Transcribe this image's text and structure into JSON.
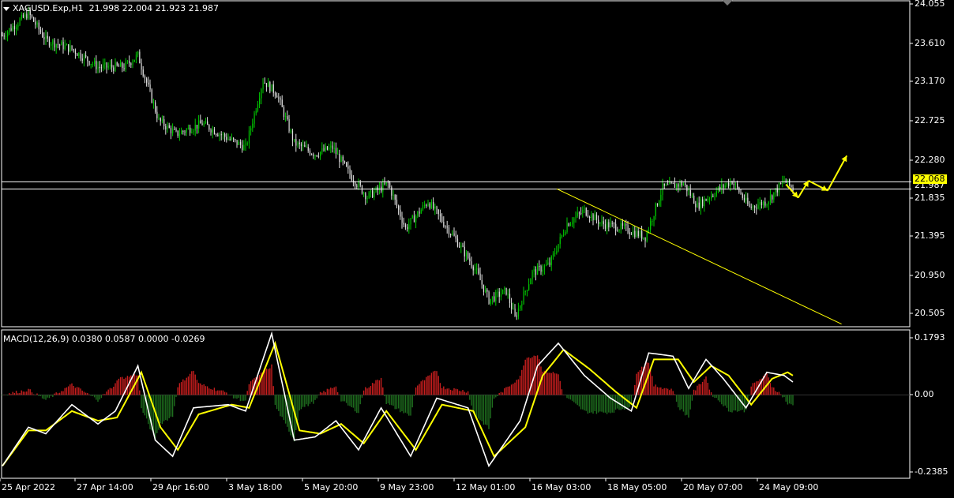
{
  "header": {
    "symbol_timeframe": "XAGUSD.Exp,H1",
    "ohlc": "21.998 22.004 21.923 21.987"
  },
  "colors": {
    "background": "#000000",
    "grid_frame": "#ffffff",
    "bull_candle": "#00c800",
    "bear_candle": "#e0e0e0",
    "hline": "#ffffff",
    "trendline": "#ffff00",
    "arrow": "#ffff00",
    "macd_pos": "#c81e1e",
    "macd_neg": "#1e6e1e",
    "macd_line": "#ffffff",
    "signal_line": "#ffff00"
  },
  "price_panel": {
    "current_price_tag": "22.068",
    "bid_label": "21.987",
    "ticks": [
      "24.055",
      "23.610",
      "23.170",
      "22.725",
      "22.280",
      "21.835",
      "21.395",
      "20.950",
      "20.505"
    ]
  },
  "macd_panel": {
    "title": "MACD(12,26,9) 0.0380 0.0587 0.0000 -0.0269",
    "ticks": [
      "0.1793",
      "0.00",
      "-0.2385"
    ]
  },
  "time_axis": {
    "labels": [
      "25 Apr 2022",
      "27 Apr 14:00",
      "29 Apr 16:00",
      "3 May 18:00",
      "5 May 20:00",
      "9 May 23:00",
      "12 May 01:00",
      "16 May 03:00",
      "18 May 05:00",
      "20 May 07:00",
      "24 May 09:00"
    ]
  },
  "chart_data": {
    "type": "candlestick",
    "symbol": "XAGUSD.Exp",
    "timeframe": "H1",
    "y_range": [
      20.45,
      24.08
    ],
    "anchors": [
      [
        0,
        23.7
      ],
      [
        15,
        23.95
      ],
      [
        25,
        23.65
      ],
      [
        40,
        23.55
      ],
      [
        55,
        23.35
      ],
      [
        70,
        23.35
      ],
      [
        78,
        23.48
      ],
      [
        90,
        22.75
      ],
      [
        100,
        22.6
      ],
      [
        115,
        22.72
      ],
      [
        130,
        22.55
      ],
      [
        140,
        22.45
      ],
      [
        150,
        23.2
      ],
      [
        158,
        23.05
      ],
      [
        168,
        22.5
      ],
      [
        180,
        22.38
      ],
      [
        190,
        22.45
      ],
      [
        200,
        22.15
      ],
      [
        210,
        21.9
      ],
      [
        222,
        22.05
      ],
      [
        232,
        21.55
      ],
      [
        245,
        21.85
      ],
      [
        260,
        21.45
      ],
      [
        272,
        21.1
      ],
      [
        280,
        20.75
      ],
      [
        290,
        20.85
      ],
      [
        295,
        20.55
      ],
      [
        305,
        21.05
      ],
      [
        315,
        21.15
      ],
      [
        325,
        21.6
      ],
      [
        335,
        21.75
      ],
      [
        345,
        21.6
      ],
      [
        358,
        21.55
      ],
      [
        370,
        21.45
      ],
      [
        380,
        22.0
      ],
      [
        392,
        22.05
      ],
      [
        400,
        21.8
      ],
      [
        412,
        21.98
      ],
      [
        420,
        22.08
      ],
      [
        430,
        21.78
      ],
      [
        440,
        21.85
      ],
      [
        450,
        22.08
      ],
      [
        455,
        21.99
      ]
    ],
    "macd": {
      "zero": 0,
      "range": [
        -0.2385,
        0.1793
      ],
      "line_anchors": [
        [
          0,
          -0.22
        ],
        [
          15,
          -0.1
        ],
        [
          25,
          -0.12
        ],
        [
          40,
          -0.03
        ],
        [
          55,
          -0.09
        ],
        [
          65,
          -0.05
        ],
        [
          78,
          0.09
        ],
        [
          88,
          -0.14
        ],
        [
          98,
          -0.19
        ],
        [
          110,
          -0.04
        ],
        [
          130,
          -0.03
        ],
        [
          140,
          -0.05
        ],
        [
          155,
          0.19
        ],
        [
          168,
          -0.14
        ],
        [
          180,
          -0.13
        ],
        [
          192,
          -0.08
        ],
        [
          205,
          -0.17
        ],
        [
          218,
          -0.04
        ],
        [
          235,
          -0.19
        ],
        [
          250,
          -0.01
        ],
        [
          268,
          -0.04
        ],
        [
          280,
          -0.22
        ],
        [
          298,
          -0.08
        ],
        [
          308,
          0.09
        ],
        [
          320,
          0.16
        ],
        [
          335,
          0.06
        ],
        [
          350,
          -0.01
        ],
        [
          362,
          -0.05
        ],
        [
          372,
          0.13
        ],
        [
          386,
          0.12
        ],
        [
          395,
          0.02
        ],
        [
          405,
          0.11
        ],
        [
          415,
          0.05
        ],
        [
          428,
          -0.04
        ],
        [
          440,
          0.07
        ],
        [
          450,
          0.06
        ],
        [
          455,
          0.04
        ]
      ],
      "signal_anchors": [
        [
          0,
          -0.22
        ],
        [
          15,
          -0.11
        ],
        [
          25,
          -0.11
        ],
        [
          40,
          -0.05
        ],
        [
          55,
          -0.08
        ],
        [
          66,
          -0.07
        ],
        [
          80,
          0.07
        ],
        [
          91,
          -0.1
        ],
        [
          101,
          -0.17
        ],
        [
          113,
          -0.06
        ],
        [
          132,
          -0.03
        ],
        [
          142,
          -0.04
        ],
        [
          157,
          0.16
        ],
        [
          171,
          -0.11
        ],
        [
          183,
          -0.12
        ],
        [
          195,
          -0.09
        ],
        [
          208,
          -0.15
        ],
        [
          221,
          -0.05
        ],
        [
          238,
          -0.17
        ],
        [
          253,
          -0.03
        ],
        [
          271,
          -0.05
        ],
        [
          283,
          -0.19
        ],
        [
          301,
          -0.1
        ],
        [
          311,
          0.06
        ],
        [
          323,
          0.14
        ],
        [
          338,
          0.08
        ],
        [
          353,
          0.01
        ],
        [
          365,
          -0.04
        ],
        [
          375,
          0.11
        ],
        [
          389,
          0.11
        ],
        [
          398,
          0.04
        ],
        [
          408,
          0.09
        ],
        [
          418,
          0.06
        ],
        [
          431,
          -0.03
        ],
        [
          443,
          0.05
        ],
        [
          452,
          0.07
        ],
        [
          455,
          0.06
        ]
      ]
    },
    "horizontal_lines": [
      22.068,
      21.987
    ],
    "trendline": {
      "from": [
        319,
        21.99
      ],
      "to": [
        483,
        20.48
      ]
    },
    "forecast_arrows": [
      [
        451,
        22.04
      ],
      [
        458,
        21.89
      ],
      [
        464,
        22.08
      ],
      [
        475,
        21.97
      ],
      [
        486,
        22.36
      ]
    ]
  }
}
